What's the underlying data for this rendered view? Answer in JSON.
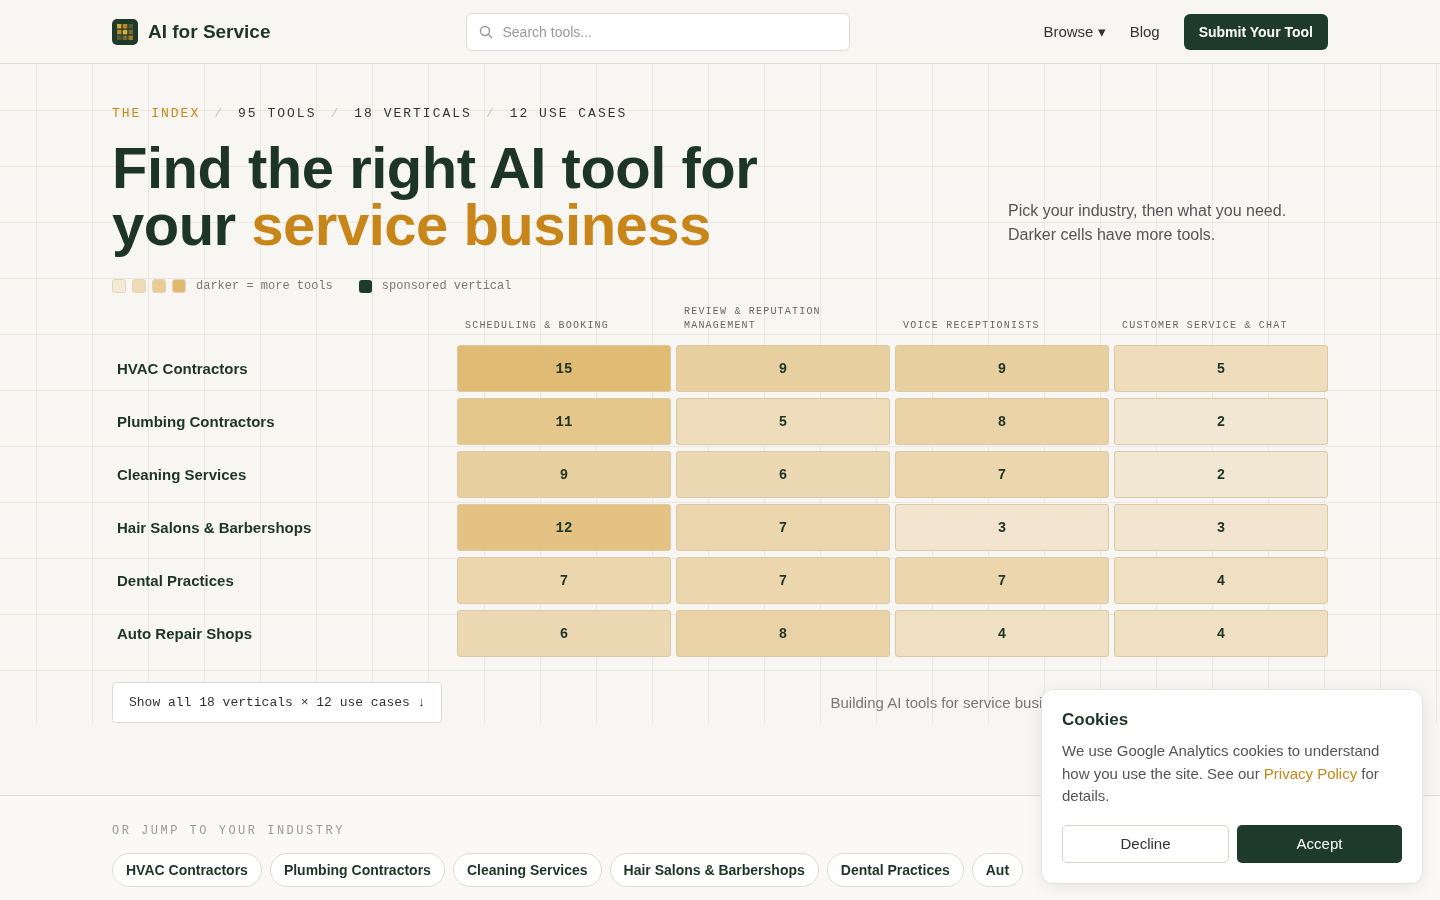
{
  "header": {
    "logo_text": "AI for Service",
    "search": {
      "placeholder": "Search tools..."
    },
    "nav": [
      {
        "label": "Browse",
        "caret": "▾"
      },
      {
        "label": "Blog"
      }
    ],
    "cta": "Submit Your Tool"
  },
  "hero": {
    "breadcrumb": [
      {
        "text": "THE INDEX",
        "kind": "accent"
      },
      {
        "text": "/",
        "kind": "sep"
      },
      {
        "text": "95 TOOLS",
        "kind": "plain"
      },
      {
        "text": "/",
        "kind": "sep"
      },
      {
        "text": "18 VERTICALS",
        "kind": "plain"
      },
      {
        "text": "/",
        "kind": "sep"
      },
      {
        "text": "12 USE CASES",
        "kind": "plain"
      }
    ],
    "title_line1": "Find the right AI tool for",
    "title_line2_plain": "your",
    "title_line2_accent": "service business",
    "subtitle": "Pick your industry, then what you need. Darker cells have more tools.",
    "legend": {
      "swatches": [
        {
          "color": "#f3ead8"
        },
        {
          "color": "#eedcb8"
        },
        {
          "color": "#e8cc94"
        },
        {
          "color": "#e0b96c"
        }
      ],
      "scale_label": "darker = more tools",
      "sponsored": {
        "color": "#1e3a2b",
        "label": "sponsored vertical"
      }
    }
  },
  "matrix": {
    "columns": [
      "SCHEDULING & BOOKING",
      "REVIEW & REPUTATION MANAGEMENT",
      "VOICE RECEPTIONISTS",
      "CUSTOMER SERVICE & CHAT"
    ],
    "rows": [
      {
        "name": "HVAC Contractors",
        "cells": [
          {
            "value": "15",
            "color": "#e0bb73"
          },
          {
            "value": "9",
            "color": "#e8cf9f"
          },
          {
            "value": "9",
            "color": "#e8cf9f"
          },
          {
            "value": "5",
            "color": "#eedcbb"
          }
        ]
      },
      {
        "name": "Plumbing Contractors",
        "cells": [
          {
            "value": "11",
            "color": "#e5c68b"
          },
          {
            "value": "5",
            "color": "#eedcbb"
          },
          {
            "value": "8",
            "color": "#e9d2a5"
          },
          {
            "value": "2",
            "color": "#f2e7d3"
          }
        ]
      },
      {
        "name": "Cleaning Services",
        "cells": [
          {
            "value": "9",
            "color": "#e8cf9f"
          },
          {
            "value": "6",
            "color": "#ecd9b3"
          },
          {
            "value": "7",
            "color": "#ebd6ae"
          },
          {
            "value": "2",
            "color": "#f2e7d3"
          }
        ]
      },
      {
        "name": "Hair Salons & Barbershops",
        "cells": [
          {
            "value": "12",
            "color": "#e3c283"
          },
          {
            "value": "7",
            "color": "#ebd6ae"
          },
          {
            "value": "3",
            "color": "#f1e5cf"
          },
          {
            "value": "3",
            "color": "#f1e5cf"
          }
        ]
      },
      {
        "name": "Dental Practices",
        "cells": [
          {
            "value": "7",
            "color": "#ebd6ae"
          },
          {
            "value": "7",
            "color": "#ebd6ae"
          },
          {
            "value": "7",
            "color": "#ebd6ae"
          },
          {
            "value": "4",
            "color": "#efe0c2"
          }
        ]
      },
      {
        "name": "Auto Repair Shops",
        "cells": [
          {
            "value": "6",
            "color": "#ecd9b3"
          },
          {
            "value": "8",
            "color": "#e9d2a5"
          },
          {
            "value": "4",
            "color": "#efe0c2"
          },
          {
            "value": "4",
            "color": "#efe0c2"
          }
        ]
      }
    ]
  },
  "show_all_button": "Show all 18 verticals × 12 use cases ↓",
  "building_text": "Building AI tools for service busi",
  "jump": {
    "label": "OR JUMP TO YOUR INDUSTRY",
    "chips": [
      "HVAC Contractors",
      "Plumbing Contractors",
      "Cleaning Services",
      "Hair Salons & Barbershops",
      "Dental Practices",
      "Aut"
    ]
  },
  "cookie": {
    "title": "Cookies",
    "text_before": "We use Google Analytics cookies to understand how you use the site. See our",
    "link": "Privacy Policy",
    "text_after": "for details.",
    "decline": "Decline",
    "accept": "Accept"
  }
}
